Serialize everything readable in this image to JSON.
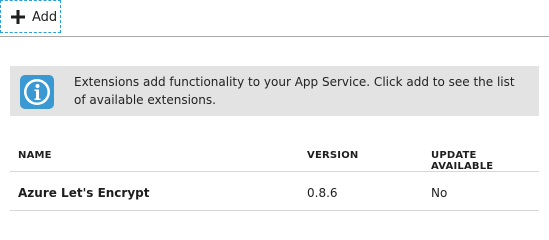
{
  "toolbar": {
    "add_label": "Add",
    "add_icon": "plus-icon"
  },
  "info_banner": {
    "icon": "info-icon",
    "icon_color": "#3a99d3",
    "text": "Extensions add functionality to your App Service. Click add to see the list of available extensions."
  },
  "table": {
    "columns": [
      "NAME",
      "VERSION",
      "UPDATE AVAILABLE"
    ],
    "rows": [
      {
        "name": "Azure Let's Encrypt",
        "version": "0.8.6",
        "update_available": "No"
      }
    ]
  }
}
